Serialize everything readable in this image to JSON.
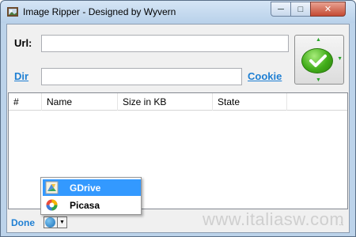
{
  "window": {
    "title": "Image Ripper - Designed by Wyvern",
    "controls": {
      "minimize": "─",
      "maximize": "□",
      "close": "✕"
    }
  },
  "form": {
    "url_label": "Url:",
    "url_value": "",
    "dir_label": "Dir",
    "dir_value": "",
    "cookie_label": "Cookie"
  },
  "list": {
    "columns": [
      "#",
      "Name",
      "Size in KB",
      "State"
    ]
  },
  "status": {
    "text": "Done"
  },
  "menu": {
    "items": [
      {
        "label": "GDrive",
        "icon": "gdrive-icon",
        "selected": true
      },
      {
        "label": "Picasa",
        "icon": "picasa-icon",
        "selected": false
      }
    ]
  },
  "watermark": "www.italiasw.com",
  "colors": {
    "link": "#1e7fd3",
    "selection": "#3399ff",
    "go_button": "#41ad19"
  }
}
